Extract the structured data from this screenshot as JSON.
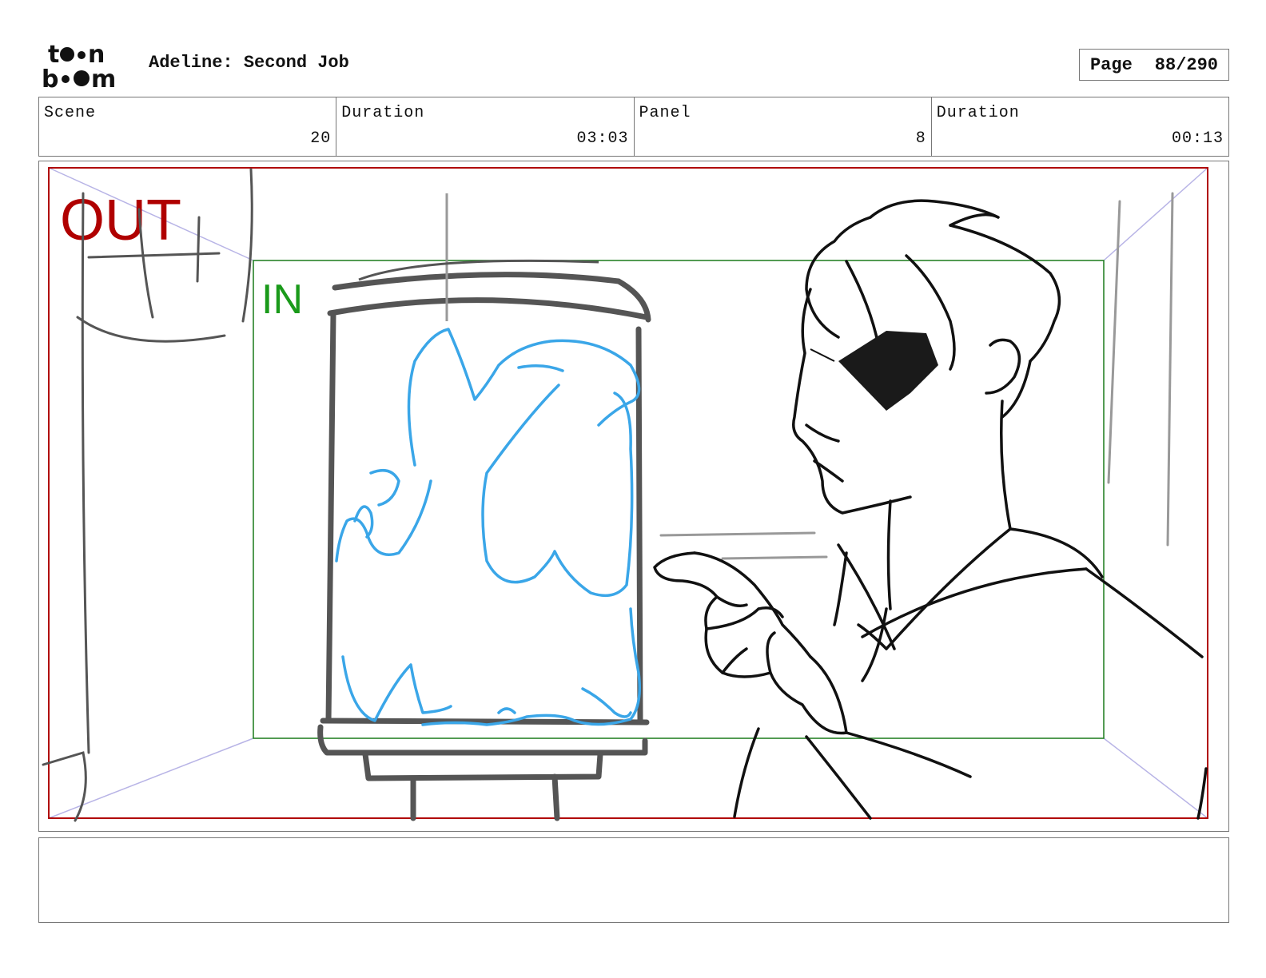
{
  "header": {
    "logo_top": "toon",
    "logo_bottom": "boom",
    "title": "Adeline: Second Job",
    "page_label": "Page",
    "page_value": "88/290"
  },
  "meta": {
    "scene_label": "Scene",
    "scene_value": "20",
    "scene_duration_label": "Duration",
    "scene_duration_value": "03:03",
    "panel_label": "Panel",
    "panel_value": "8",
    "panel_duration_label": "Duration",
    "panel_duration_value": "00:13"
  },
  "frame": {
    "out_label": "OUT",
    "in_label": "IN",
    "out_color": "#b00000",
    "in_color": "#1a8a1a"
  },
  "notes": {
    "text": ""
  }
}
